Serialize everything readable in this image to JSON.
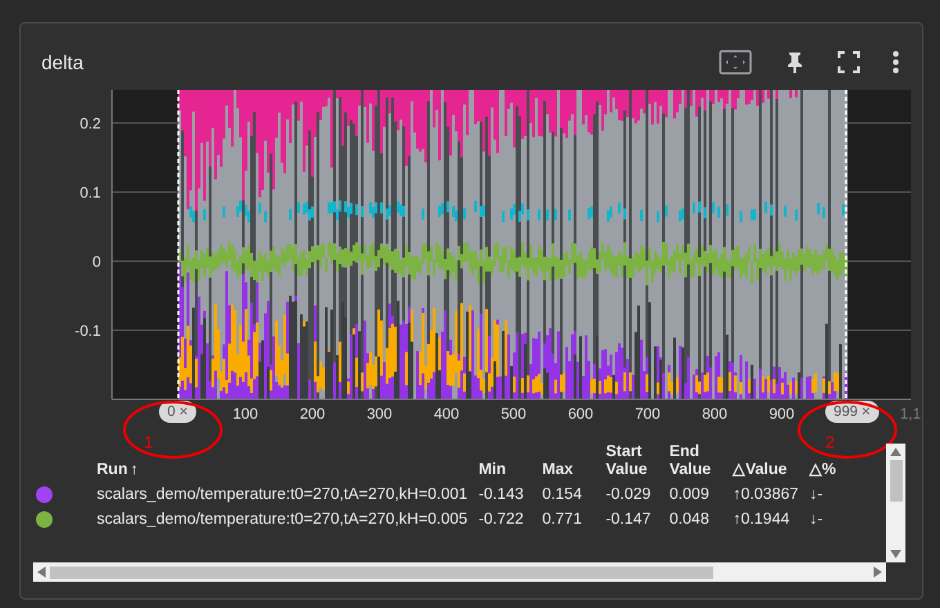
{
  "card": {
    "title": "delta"
  },
  "chart": {
    "y_axis_labels": [
      "0.2",
      "0.1",
      "0",
      "-0.1"
    ],
    "x_axis_labels": [
      "100",
      "200",
      "300",
      "400",
      "500",
      "600",
      "700",
      "800",
      "900",
      "1,1"
    ],
    "range_chips": [
      {
        "label": "0",
        "close": "×"
      },
      {
        "label": "999",
        "close": "×"
      }
    ],
    "annotations": [
      {
        "label": "1"
      },
      {
        "label": "2"
      }
    ]
  },
  "table": {
    "columns": [
      {
        "label": "Run",
        "sort": "↑"
      },
      {
        "label": "Min"
      },
      {
        "label": "Max"
      },
      {
        "label": "Start Value"
      },
      {
        "label": "End Value"
      },
      {
        "label": "△Value"
      },
      {
        "label": "△%"
      }
    ],
    "rows": [
      {
        "color": "#a142f4",
        "cells": [
          "scalars_demo/temperature:t0=270,tA=270,kH=0.001",
          "-0.143",
          "0.154",
          "-0.029",
          "0.009",
          "↑0.03867",
          "↓-"
        ]
      },
      {
        "color": "#7cb342",
        "cells": [
          "scalars_demo/temperature:t0=270,tA=270,kH=0.005",
          "-0.722",
          "0.771",
          "-0.147",
          "0.048",
          "↑0.1944",
          "↓-"
        ]
      }
    ]
  }
}
